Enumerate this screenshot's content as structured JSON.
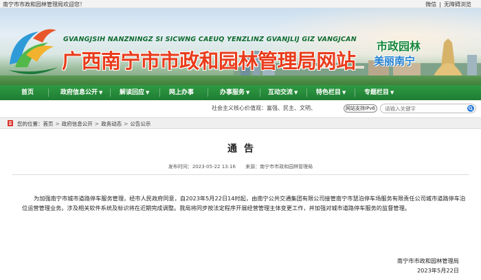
{
  "topbar": {
    "welcome": "南宁市市政和园林管理局欢迎您！",
    "links": [
      "微信",
      "无障碍浏览"
    ]
  },
  "banner": {
    "pinyin": "GVANGJSIH NANZNINGZ SI SICWNG CAEUQ YENZLINZ GVANJLIJ GIZ VANGJCAN",
    "title": "广西南宁市市政和园林管理局网站",
    "slogan_line1": "市政园林",
    "slogan_line2": "美丽南宁"
  },
  "nav": {
    "items": [
      {
        "label": "首页",
        "dropdown": false
      },
      {
        "label": "政府信息公开",
        "dropdown": true
      },
      {
        "label": "解读回应",
        "dropdown": true
      },
      {
        "label": "网上办事",
        "dropdown": false
      },
      {
        "label": "办事服务",
        "dropdown": true
      },
      {
        "label": "互动交流",
        "dropdown": true
      },
      {
        "label": "特色栏目",
        "dropdown": true
      },
      {
        "label": "专题栏目",
        "dropdown": true
      }
    ],
    "arrow": "▼"
  },
  "toolbar": {
    "core_values": "社会主义核心价值观：富强、民主、文明、",
    "aria_button": "网站支持IPv6",
    "search_placeholder": "请输入关键字"
  },
  "breadcrumb": {
    "prefix": "您的位置：",
    "items": [
      "首页",
      "政府信息公开",
      "政务动态",
      "公告公示"
    ],
    "separator": ">"
  },
  "article": {
    "title": "通告",
    "publish_time_label": "发布时间：2023-05-22 13:16",
    "source_label": "来源：南宁市市政和园林管理局",
    "body": "为加强南宁市城市道路停车服务管理，经市人民政府同意，自2023年5月22日14时起，由南宁公共交通集团有限公司接管南宁市慧泊停车场服务有限责任公司城市道路停车泊位运营管理业务。涉及相关软件系统及标识将在近期完成调整。我局将同步按法定程序开展经营管理主体变更工作，并加强对城市道路停车服务的监督管理。",
    "signature": "南宁市市政和园林管理局",
    "date": "2023年5月22日"
  },
  "colors": {
    "nav_green": "#1e7d32",
    "title_red": "#e93c1c",
    "slogan_green": "#17873a",
    "slogan_blue": "#1f7fd0"
  }
}
